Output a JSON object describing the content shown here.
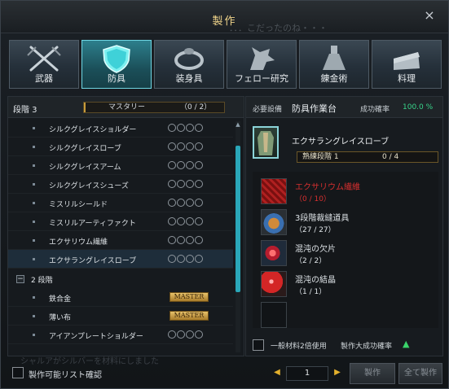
{
  "window": {
    "title": "製作",
    "close_label": "×",
    "ghost_text": "．．．こだったのね・・・"
  },
  "tabs": [
    {
      "label": "武器",
      "icon": "crossed-swords-icon",
      "active": false
    },
    {
      "label": "防具",
      "icon": "shield-icon",
      "active": true
    },
    {
      "label": "装身具",
      "icon": "ring-icon",
      "active": false
    },
    {
      "label": "フェロー研究",
      "icon": "dragon-head-icon",
      "active": false
    },
    {
      "label": "錬金術",
      "icon": "flask-icon",
      "active": false
    },
    {
      "label": "料理",
      "icon": "cake-icon",
      "active": false
    }
  ],
  "left": {
    "tier_label": "段階 3",
    "mastery_label": "マスタリー",
    "mastery_value": "（0 / 2）",
    "mastery_progress": 0.0,
    "items": [
      {
        "name": "シルクグレイスショルダー",
        "kind": "circles",
        "selected": false
      },
      {
        "name": "シルクグレイスローブ",
        "kind": "circles",
        "selected": false
      },
      {
        "name": "シルクグレイスアーム",
        "kind": "circles",
        "selected": false
      },
      {
        "name": "シルクグレイスシューズ",
        "kind": "circles",
        "selected": false
      },
      {
        "name": "ミスリルシールド",
        "kind": "circles",
        "selected": false
      },
      {
        "name": "ミスリルアーティファクト",
        "kind": "circles",
        "selected": false
      },
      {
        "name": "エクサリウム繊維",
        "kind": "circles",
        "selected": false
      },
      {
        "name": "エクサラングレイスローブ",
        "kind": "circles",
        "selected": true
      }
    ],
    "group_label": "2 段階",
    "group_items": [
      {
        "name": "鉄合金",
        "badge": "MASTER"
      },
      {
        "name": "薄い布",
        "badge": "MASTER"
      },
      {
        "name": "アイアンプレートショルダー",
        "badge": ""
      }
    ]
  },
  "right": {
    "station_label": "必要設備",
    "station": "防具作業台",
    "rate_label": "成功確率",
    "rate": "100.0 %",
    "product_name": "エクサラングレイスローブ",
    "proficiency_label": "熟練段階 1",
    "proficiency_value": "0 / 4",
    "materials": [
      {
        "name": "エクサリウム繊維",
        "count": "（0 / 10）",
        "missing": true,
        "icon": "red-fiber-icon"
      },
      {
        "name": "3段階裁縫道具",
        "count": "（27 / 27）",
        "missing": false,
        "icon": "sewing-kit-icon"
      },
      {
        "name": "混沌の欠片",
        "count": "（2 / 2）",
        "missing": false,
        "icon": "chaos-fragment-icon"
      },
      {
        "name": "混沌の結晶",
        "count": "（1 / 1）",
        "missing": false,
        "icon": "chaos-crystal-icon"
      },
      {
        "name": "",
        "count": "",
        "missing": false,
        "icon": "empty-slot-icon"
      }
    ],
    "double_label": "一般材料2倍使用",
    "double_label2": "製作大成功確率"
  },
  "bottom": {
    "craftable_label": "製作可能リスト確認",
    "faded_text": "シャルアがシルバーを材料にしました",
    "quantity": "1",
    "craft_label": "製作",
    "craft_all_label": "全て製作"
  },
  "colors": {
    "accent": "#2aa7b9",
    "gold": "#f0d48a",
    "missing": "#d62f2f",
    "success": "#38d38a"
  }
}
